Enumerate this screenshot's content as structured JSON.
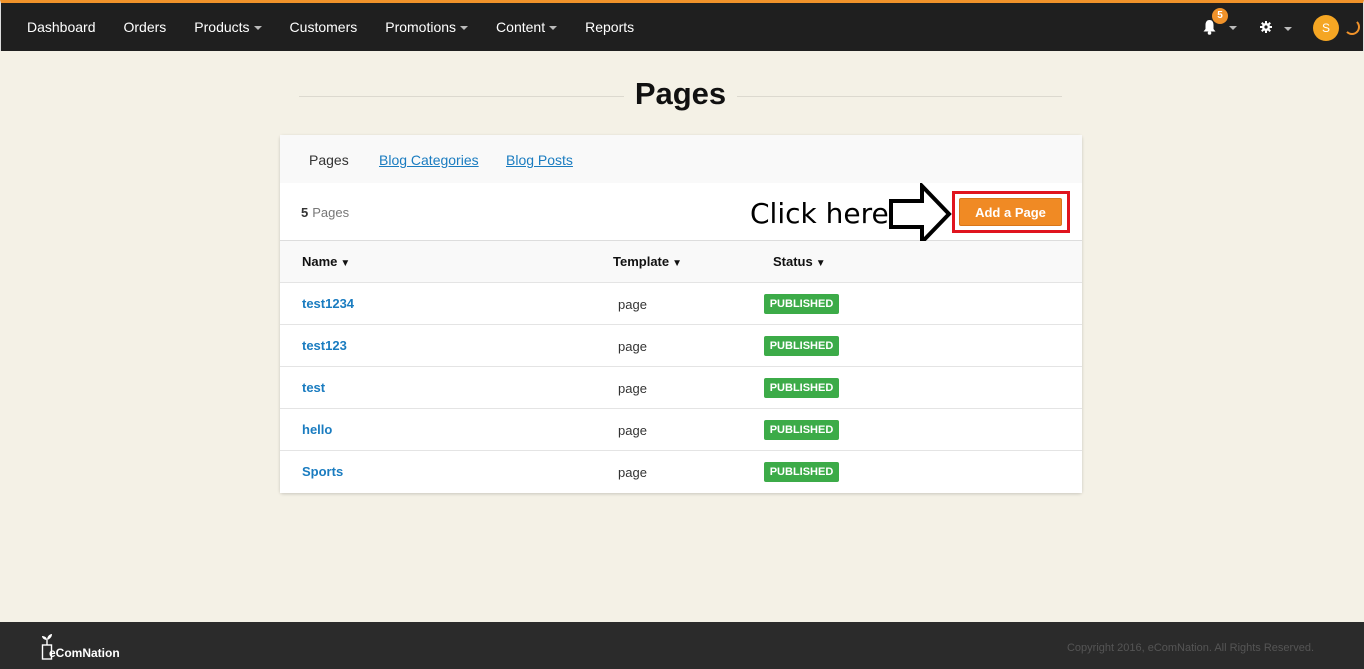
{
  "nav": {
    "items": [
      {
        "label": "Dashboard",
        "dropdown": false
      },
      {
        "label": "Orders",
        "dropdown": false
      },
      {
        "label": "Products",
        "dropdown": true
      },
      {
        "label": "Customers",
        "dropdown": false
      },
      {
        "label": "Promotions",
        "dropdown": true
      },
      {
        "label": "Content",
        "dropdown": true
      },
      {
        "label": "Reports",
        "dropdown": false
      }
    ],
    "notification_count": "5",
    "avatar_initial": "S"
  },
  "page": {
    "title": "Pages"
  },
  "tabs": [
    {
      "label": "Pages",
      "active": true
    },
    {
      "label": "Blog Categories",
      "active": false
    },
    {
      "label": "Blog Posts",
      "active": false
    }
  ],
  "toolbar": {
    "count": "5",
    "count_label": "Pages",
    "annotation": "Click here",
    "add_button_label": "Add a Page"
  },
  "table": {
    "columns": [
      {
        "label": "Name",
        "sort": "▼"
      },
      {
        "label": "Template",
        "sort": "▼"
      },
      {
        "label": "Status",
        "sort": "▼"
      }
    ],
    "rows": [
      {
        "name": "test1234",
        "template": "page",
        "status": "PUBLISHED"
      },
      {
        "name": "test123",
        "template": "page",
        "status": "PUBLISHED"
      },
      {
        "name": "test",
        "template": "page",
        "status": "PUBLISHED"
      },
      {
        "name": "hello",
        "template": "page",
        "status": "PUBLISHED"
      },
      {
        "name": "Sports",
        "template": "page",
        "status": "PUBLISHED"
      }
    ]
  },
  "footer": {
    "logo_text": "eComNation",
    "copyright": "Copyright 2016, eComNation. All Rights Reserved."
  },
  "colors": {
    "accent": "#f08a24",
    "link": "#1a7cc0",
    "status_published": "#3cab48",
    "highlight": "#e0141e"
  }
}
